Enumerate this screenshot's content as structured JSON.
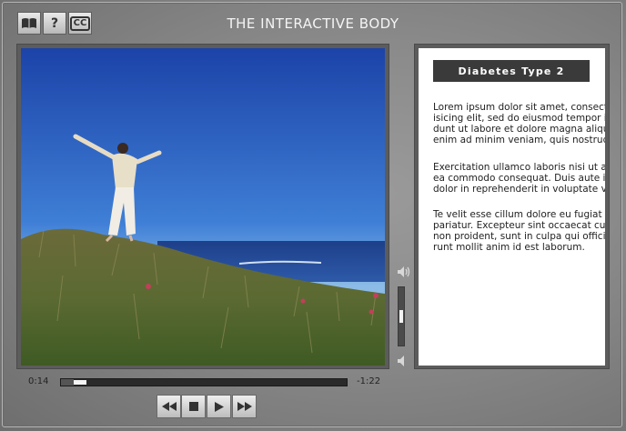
{
  "window": {
    "title": "THE INTERACTIVE BODY"
  },
  "toolbar": {
    "help_label": "?",
    "cc_label": "CC",
    "icons": [
      "book-icon",
      "help-icon",
      "closed-caption-icon"
    ]
  },
  "video": {
    "current_time": "0:14",
    "remaining_time": "-1:22",
    "progress": 0.045,
    "volume": 0.5
  },
  "panel": {
    "title": "Diabetes Type 2",
    "paragraphs": [
      "Lorem ipsum dolor sit amet, consectetur\nisicing elit, sed do eiusmod tempor inci\ndunt ut labore et dolore magna aliqua. Ut\nenim ad minim veniam, quis nostrud",
      "Exercitation ullamco laboris nisi ut aliquip\nea commodo consequat. Duis aute irure\ndolor in reprehenderit in voluptate velit",
      "Te velit esse cillum dolore eu fugiat nulla\npariatur. Excepteur sint occaecat cupidatat\nnon proident, sunt in culpa qui officia dese\nrunt mollit anim id est laborum."
    ]
  },
  "controls": {
    "rewind_icon": "rewind-icon",
    "stop_icon": "stop-icon",
    "play_icon": "play-icon",
    "fast_forward_icon": "fast-forward-icon"
  },
  "colors": {
    "panel_title_bg": "#3a3a3a",
    "sky": "#1f4fb3",
    "frame": "#5c5c5c"
  }
}
